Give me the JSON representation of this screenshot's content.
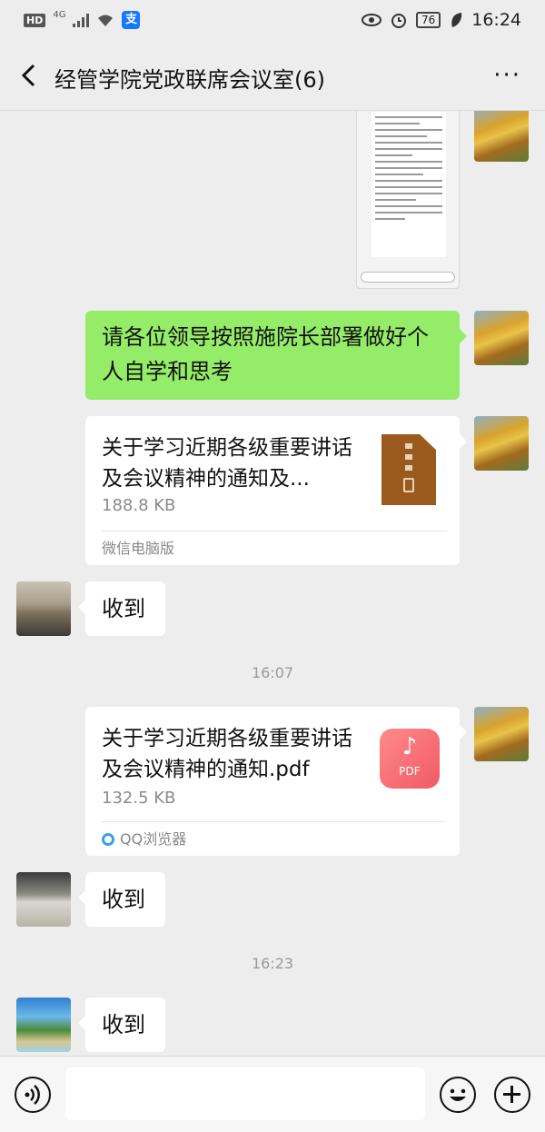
{
  "status_bar": {
    "hd_label": "HD",
    "network_label": "4G",
    "battery_level": "76",
    "time": "16:24",
    "icons": [
      "hd-icon",
      "signal-icon",
      "wifi-icon",
      "alipay-icon",
      "eye-icon",
      "alarm-icon",
      "battery-icon",
      "leaf-icon"
    ]
  },
  "header": {
    "title": "经管学院党政联席会议室(6)",
    "back_icon": "chevron-left-icon",
    "more_icon": "more-dots-icon",
    "more_label": "···"
  },
  "messages": [
    {
      "type": "image",
      "side": "right",
      "content": "screenshot-image"
    },
    {
      "type": "text",
      "side": "right",
      "text": "请各位领导按照施院长部署做好个人自学和思考"
    },
    {
      "type": "file",
      "side": "right",
      "title": "关于学习近期各级重要讲话及会议精神的通知及...",
      "size": "188.8 KB",
      "source": "微信电脑版",
      "file_icon": "zip-file-icon"
    },
    {
      "type": "text",
      "side": "left",
      "text": "收到"
    },
    {
      "type": "timestamp",
      "text": "16:07"
    },
    {
      "type": "file",
      "side": "right",
      "title": "关于学习近期各级重要讲话及会议精神的通知.pdf",
      "size": "132.5 KB",
      "source": "QQ浏览器",
      "file_icon": "pdf-file-icon",
      "pdf_label": "PDF"
    },
    {
      "type": "text",
      "side": "left",
      "text": "收到"
    },
    {
      "type": "timestamp",
      "text": "16:23"
    },
    {
      "type": "text",
      "side": "left",
      "text": "收到"
    }
  ],
  "input_bar": {
    "voice_icon": "voice-icon",
    "emoji_icon": "emoji-icon",
    "plus_icon": "plus-icon",
    "input_value": ""
  },
  "colors": {
    "background": "#ededed",
    "sent_bubble": "#95ec69",
    "received_bubble": "#ffffff",
    "pdf_icon": "#f05a64",
    "zip_icon": "#9a5a1e"
  }
}
